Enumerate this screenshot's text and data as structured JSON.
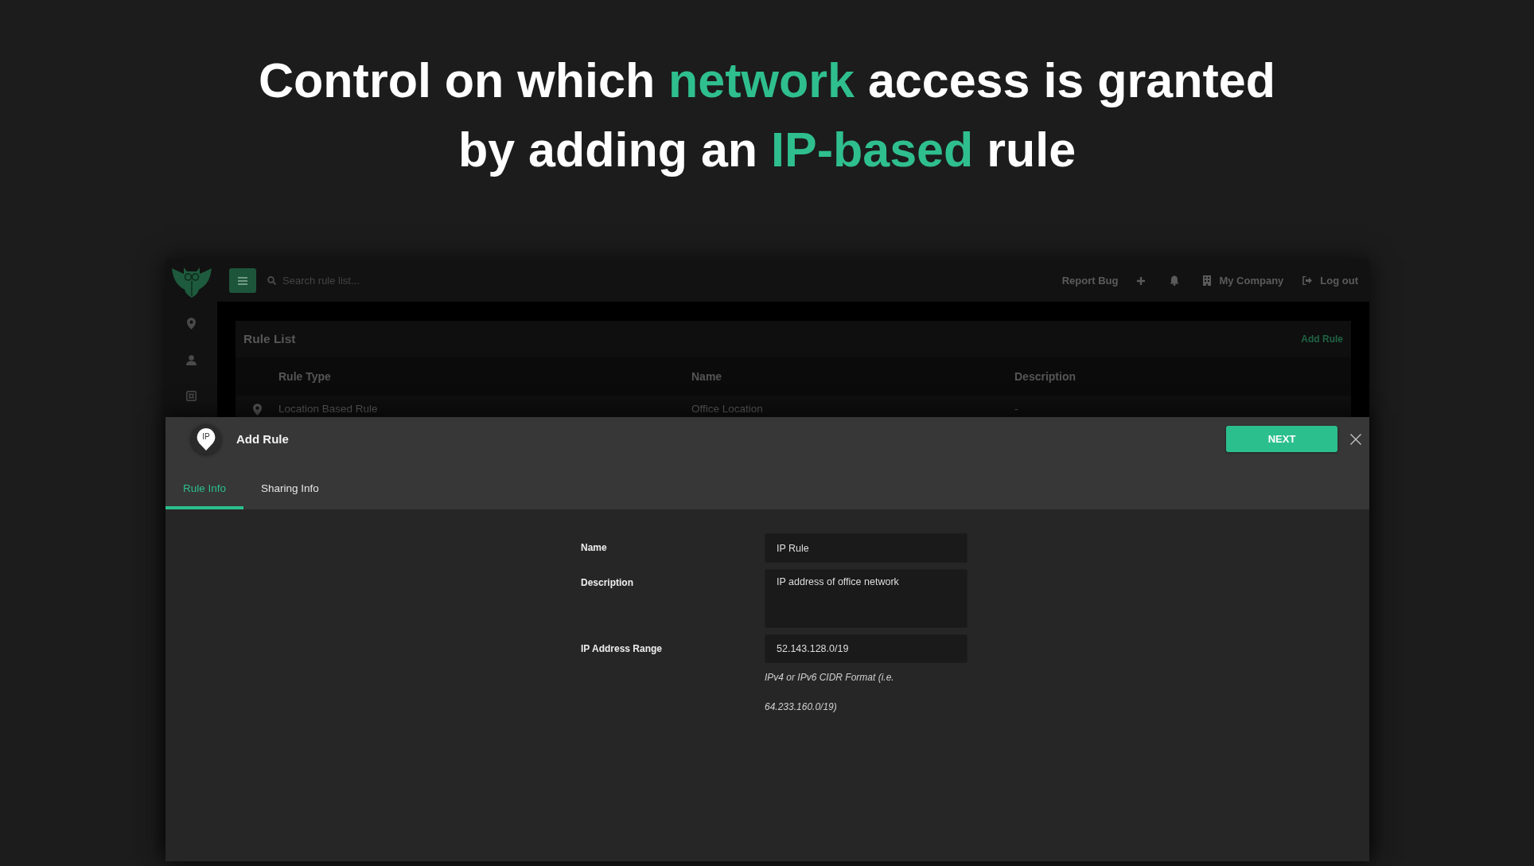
{
  "headline": {
    "lines": [
      [
        {
          "text": "Control on which ",
          "accent": false
        },
        {
          "text": "network",
          "accent": true
        },
        {
          "text": " access is granted",
          "accent": false
        }
      ],
      [
        {
          "text": "by adding an ",
          "accent": false
        },
        {
          "text": "IP-based",
          "accent": true
        },
        {
          "text": " rule",
          "accent": false
        }
      ]
    ]
  },
  "topbar": {
    "search_placeholder": "Search rule list...",
    "report_link": "Report Bug",
    "company": "My Company",
    "logout": "Log out"
  },
  "rule_list": {
    "title": "Rule List",
    "add_link": "Add Rule",
    "columns": [
      "Rule Type",
      "Name",
      "Description"
    ],
    "rows": [
      {
        "cells": [
          "Location Based Rule",
          "Office Location",
          "-"
        ]
      }
    ]
  },
  "modal": {
    "badge": "IP",
    "title": "Add Rule",
    "primary_button": "NEXT",
    "tabs": [
      {
        "label": "Rule Info",
        "selected": true
      },
      {
        "label": "Sharing Info",
        "selected": false
      }
    ],
    "fields": [
      {
        "kind": "input",
        "label": "Name",
        "value": "IP Rule"
      },
      {
        "kind": "textarea",
        "label": "Description",
        "value": "IP address of office network"
      },
      {
        "kind": "input",
        "label": "IP Address Range",
        "value": "52.143.128.0/19",
        "hint": "IPv4 or IPv6 CIDR Format (i.e. 64.233.160.0/19)"
      }
    ]
  }
}
